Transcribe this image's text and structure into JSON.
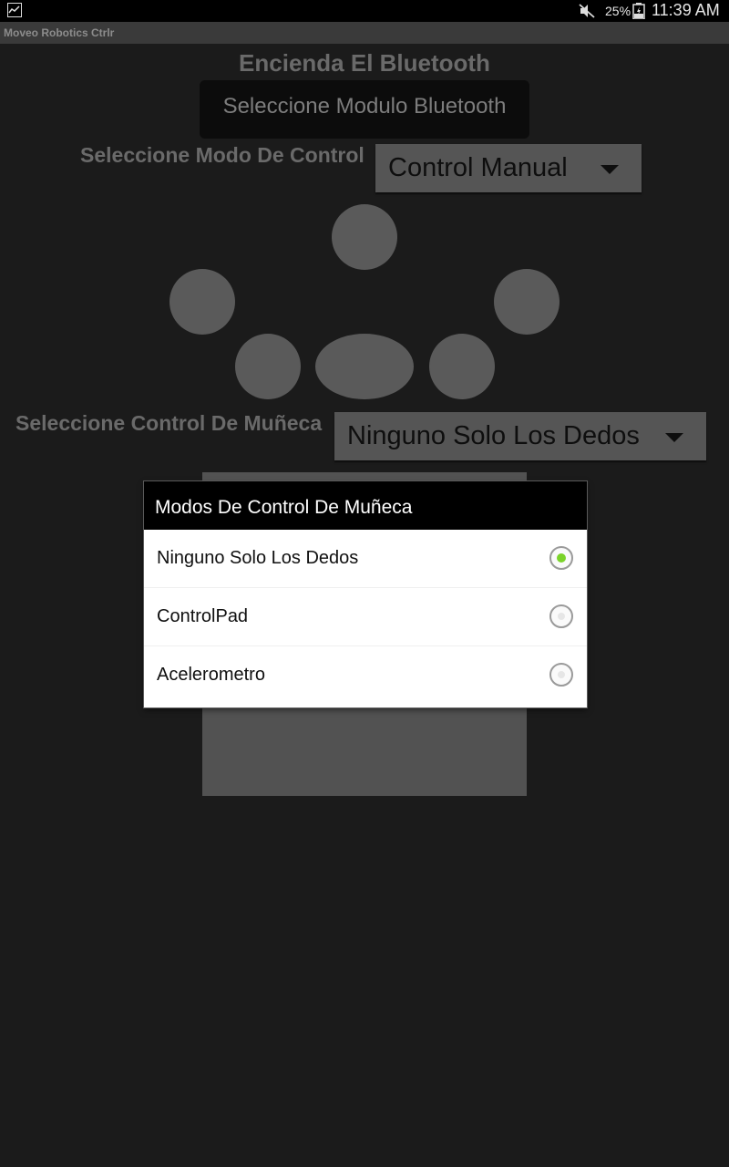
{
  "status_bar": {
    "left_icon": "image-icon",
    "icons": [
      "mute-icon",
      "battery-charging-icon"
    ],
    "battery_percent": "25%",
    "time": "11:39 AM"
  },
  "app": {
    "title": "Moveo Robotics Ctrlr"
  },
  "main": {
    "heading": "Encienda El Bluetooth",
    "bluetooth_button_label": "Seleccione Modulo Bluetooth",
    "control_mode_label": "Seleccione Modo De Control",
    "control_mode_value": "Control Manual",
    "wrist_control_label": "Seleccione Control De Muñeca",
    "wrist_control_value": "Ninguno Solo Los Dedos"
  },
  "dialog": {
    "title": "Modos De Control De Muñeca",
    "options": [
      {
        "label": "Ninguno Solo Los Dedos",
        "checked": true
      },
      {
        "label": "ControlPad",
        "checked": false
      },
      {
        "label": "Acelerometro",
        "checked": false
      }
    ]
  },
  "colors": {
    "background": "#1b1b1b",
    "selected_radio": "#7bd32a",
    "dialog_title_bg": "#000000"
  }
}
